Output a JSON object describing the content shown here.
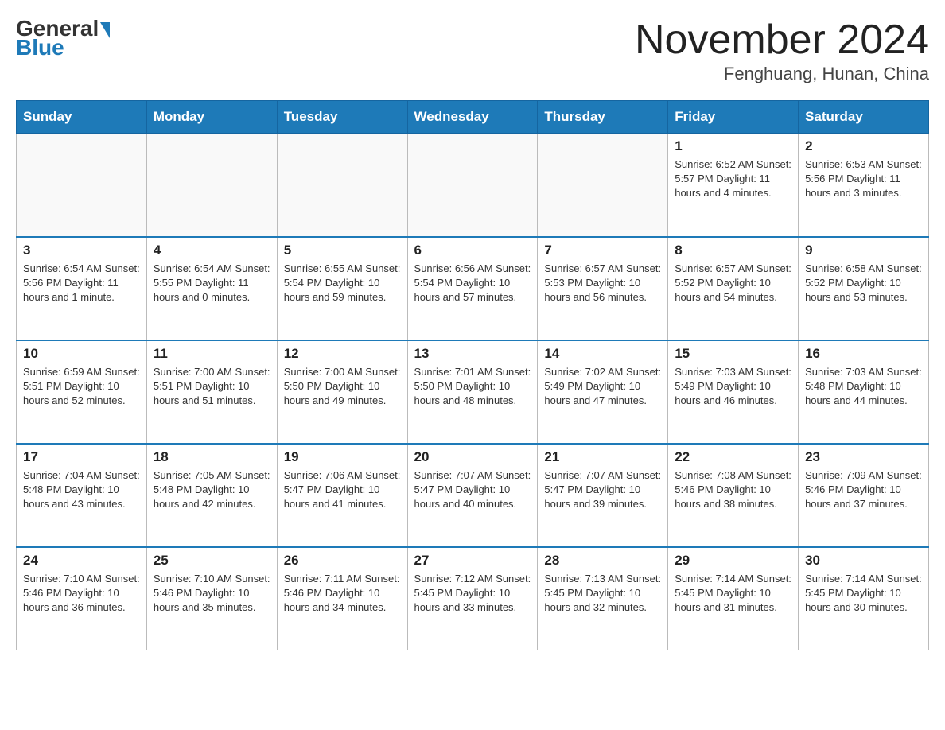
{
  "header": {
    "logo": {
      "general": "General",
      "blue": "Blue"
    },
    "title": "November 2024",
    "location": "Fenghuang, Hunan, China"
  },
  "days_of_week": [
    "Sunday",
    "Monday",
    "Tuesday",
    "Wednesday",
    "Thursday",
    "Friday",
    "Saturday"
  ],
  "weeks": [
    [
      {
        "day": "",
        "info": ""
      },
      {
        "day": "",
        "info": ""
      },
      {
        "day": "",
        "info": ""
      },
      {
        "day": "",
        "info": ""
      },
      {
        "day": "",
        "info": ""
      },
      {
        "day": "1",
        "info": "Sunrise: 6:52 AM\nSunset: 5:57 PM\nDaylight: 11 hours and 4 minutes."
      },
      {
        "day": "2",
        "info": "Sunrise: 6:53 AM\nSunset: 5:56 PM\nDaylight: 11 hours and 3 minutes."
      }
    ],
    [
      {
        "day": "3",
        "info": "Sunrise: 6:54 AM\nSunset: 5:56 PM\nDaylight: 11 hours and 1 minute."
      },
      {
        "day": "4",
        "info": "Sunrise: 6:54 AM\nSunset: 5:55 PM\nDaylight: 11 hours and 0 minutes."
      },
      {
        "day": "5",
        "info": "Sunrise: 6:55 AM\nSunset: 5:54 PM\nDaylight: 10 hours and 59 minutes."
      },
      {
        "day": "6",
        "info": "Sunrise: 6:56 AM\nSunset: 5:54 PM\nDaylight: 10 hours and 57 minutes."
      },
      {
        "day": "7",
        "info": "Sunrise: 6:57 AM\nSunset: 5:53 PM\nDaylight: 10 hours and 56 minutes."
      },
      {
        "day": "8",
        "info": "Sunrise: 6:57 AM\nSunset: 5:52 PM\nDaylight: 10 hours and 54 minutes."
      },
      {
        "day": "9",
        "info": "Sunrise: 6:58 AM\nSunset: 5:52 PM\nDaylight: 10 hours and 53 minutes."
      }
    ],
    [
      {
        "day": "10",
        "info": "Sunrise: 6:59 AM\nSunset: 5:51 PM\nDaylight: 10 hours and 52 minutes."
      },
      {
        "day": "11",
        "info": "Sunrise: 7:00 AM\nSunset: 5:51 PM\nDaylight: 10 hours and 51 minutes."
      },
      {
        "day": "12",
        "info": "Sunrise: 7:00 AM\nSunset: 5:50 PM\nDaylight: 10 hours and 49 minutes."
      },
      {
        "day": "13",
        "info": "Sunrise: 7:01 AM\nSunset: 5:50 PM\nDaylight: 10 hours and 48 minutes."
      },
      {
        "day": "14",
        "info": "Sunrise: 7:02 AM\nSunset: 5:49 PM\nDaylight: 10 hours and 47 minutes."
      },
      {
        "day": "15",
        "info": "Sunrise: 7:03 AM\nSunset: 5:49 PM\nDaylight: 10 hours and 46 minutes."
      },
      {
        "day": "16",
        "info": "Sunrise: 7:03 AM\nSunset: 5:48 PM\nDaylight: 10 hours and 44 minutes."
      }
    ],
    [
      {
        "day": "17",
        "info": "Sunrise: 7:04 AM\nSunset: 5:48 PM\nDaylight: 10 hours and 43 minutes."
      },
      {
        "day": "18",
        "info": "Sunrise: 7:05 AM\nSunset: 5:48 PM\nDaylight: 10 hours and 42 minutes."
      },
      {
        "day": "19",
        "info": "Sunrise: 7:06 AM\nSunset: 5:47 PM\nDaylight: 10 hours and 41 minutes."
      },
      {
        "day": "20",
        "info": "Sunrise: 7:07 AM\nSunset: 5:47 PM\nDaylight: 10 hours and 40 minutes."
      },
      {
        "day": "21",
        "info": "Sunrise: 7:07 AM\nSunset: 5:47 PM\nDaylight: 10 hours and 39 minutes."
      },
      {
        "day": "22",
        "info": "Sunrise: 7:08 AM\nSunset: 5:46 PM\nDaylight: 10 hours and 38 minutes."
      },
      {
        "day": "23",
        "info": "Sunrise: 7:09 AM\nSunset: 5:46 PM\nDaylight: 10 hours and 37 minutes."
      }
    ],
    [
      {
        "day": "24",
        "info": "Sunrise: 7:10 AM\nSunset: 5:46 PM\nDaylight: 10 hours and 36 minutes."
      },
      {
        "day": "25",
        "info": "Sunrise: 7:10 AM\nSunset: 5:46 PM\nDaylight: 10 hours and 35 minutes."
      },
      {
        "day": "26",
        "info": "Sunrise: 7:11 AM\nSunset: 5:46 PM\nDaylight: 10 hours and 34 minutes."
      },
      {
        "day": "27",
        "info": "Sunrise: 7:12 AM\nSunset: 5:45 PM\nDaylight: 10 hours and 33 minutes."
      },
      {
        "day": "28",
        "info": "Sunrise: 7:13 AM\nSunset: 5:45 PM\nDaylight: 10 hours and 32 minutes."
      },
      {
        "day": "29",
        "info": "Sunrise: 7:14 AM\nSunset: 5:45 PM\nDaylight: 10 hours and 31 minutes."
      },
      {
        "day": "30",
        "info": "Sunrise: 7:14 AM\nSunset: 5:45 PM\nDaylight: 10 hours and 30 minutes."
      }
    ]
  ]
}
